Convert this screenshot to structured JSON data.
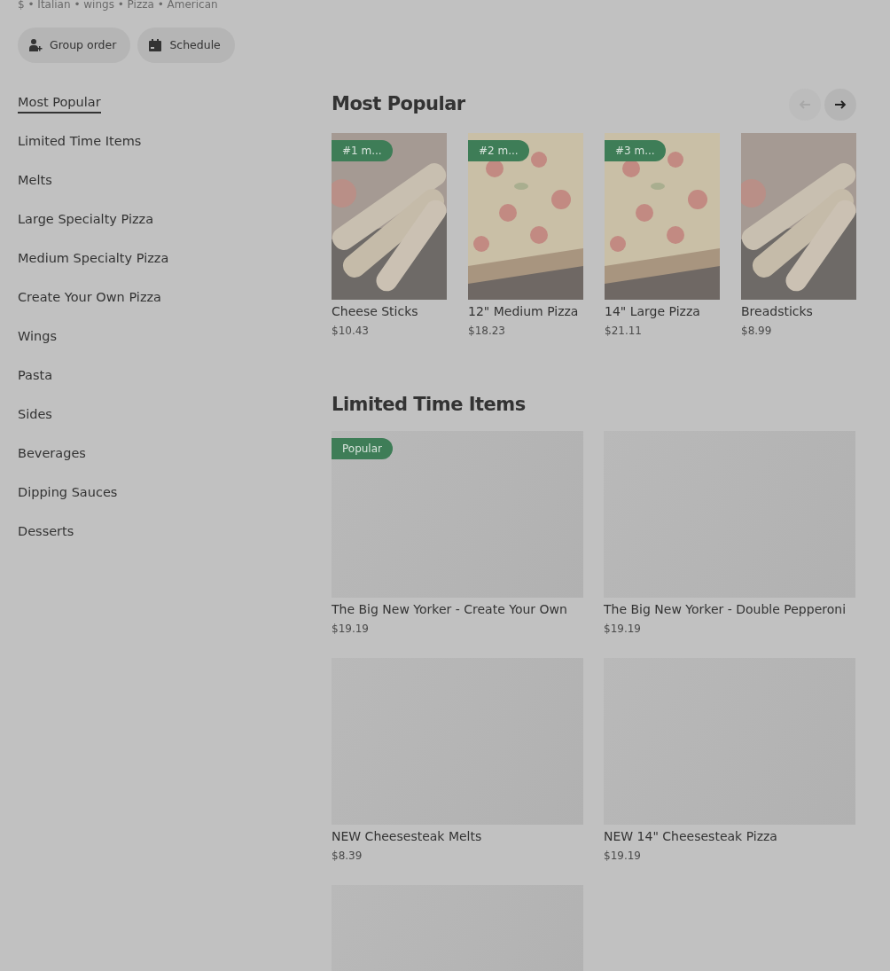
{
  "store": {
    "tags": "$ • Italian • wings • Pizza • American"
  },
  "actions": [
    {
      "kind": "group",
      "label": "Group order"
    },
    {
      "kind": "schedule",
      "label": "Schedule"
    }
  ],
  "sidebar": {
    "items": [
      {
        "label": "Most Popular",
        "selected": true
      },
      {
        "label": "Limited Time Items",
        "selected": false
      },
      {
        "label": "Melts",
        "selected": false
      },
      {
        "label": "Large Specialty Pizza",
        "selected": false
      },
      {
        "label": "Medium Specialty Pizza",
        "selected": false
      },
      {
        "label": "Create Your Own Pizza",
        "selected": false
      },
      {
        "label": "Wings",
        "selected": false
      },
      {
        "label": "Pasta",
        "selected": false
      },
      {
        "label": "Sides",
        "selected": false
      },
      {
        "label": "Beverages",
        "selected": false
      },
      {
        "label": "Dipping Sauces",
        "selected": false
      },
      {
        "label": "Desserts",
        "selected": false
      }
    ]
  },
  "most_popular": {
    "title": "Most Popular",
    "nav": [
      {
        "kind": "prev",
        "disabled": true
      },
      {
        "kind": "next",
        "disabled": false
      }
    ],
    "items": [
      {
        "badge": "#1 m...",
        "name": "Cheese Sticks",
        "price": "$10.43"
      },
      {
        "badge": "#2 m...",
        "name": "12\" Medium Pizza",
        "price": "$18.23"
      },
      {
        "badge": "#3 m...",
        "name": "14\" Large Pizza",
        "price": "$21.11"
      },
      {
        "name": "Breadsticks",
        "price": "$8.99"
      }
    ]
  },
  "limited_time": {
    "title": "Limited Time Items",
    "items": [
      {
        "kind": "placeholder",
        "badge": "Popular",
        "name": "The Big New Yorker - Create Your Own",
        "price": "$19.19"
      },
      {
        "kind": "placeholder",
        "name": "The Big New Yorker - Double Pepperoni",
        "price": "$19.19"
      },
      {
        "kind": "placeholder",
        "name": "NEW Cheesesteak Melts",
        "price": "$8.39"
      },
      {
        "kind": "placeholder",
        "name": "NEW 14\" Cheesesteak Pizza",
        "price": "$19.19"
      },
      {
        "kind": "placeholder"
      }
    ]
  }
}
